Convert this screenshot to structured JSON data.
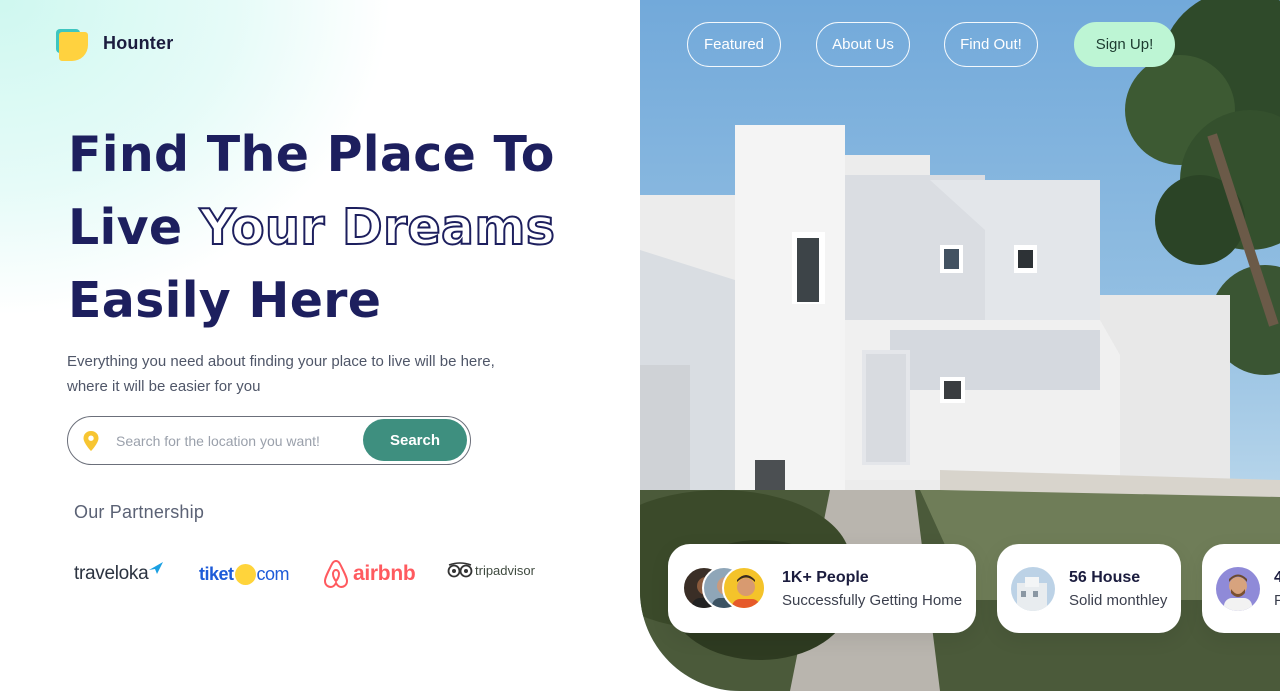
{
  "brand": {
    "name": "Hounter"
  },
  "hero": {
    "line1": "Find The Place To",
    "line2_solid": "Live",
    "line2_outline": "Your Dreams",
    "line3": "Easily Here",
    "subtext_line1": "Everything you need about finding your place to live will be here,",
    "subtext_line2": "where it will be easier for you"
  },
  "search": {
    "placeholder": "Search for the location you want!",
    "button_label": "Search",
    "icon": "location-pin-icon"
  },
  "partnership": {
    "title": "Our Partnership",
    "partners": [
      "traveloka",
      "tiket",
      "com",
      "airbnb",
      "tripadvisor"
    ]
  },
  "nav": {
    "featured": "Featured",
    "about": "About Us",
    "find_out": "Find Out!",
    "sign_up": "Sign Up!"
  },
  "stats": [
    {
      "title": "1K+ People",
      "subtitle": "Successfully Getting Home"
    },
    {
      "title": "56 House",
      "subtitle": "Solid monthley"
    },
    {
      "title": "4",
      "subtitle": "F"
    }
  ],
  "colors": {
    "heading": "#1d1f5e",
    "accent_green": "#3e8f7f",
    "signup_bg": "#bdf5d4",
    "logo_yellow": "#ffd23f",
    "logo_teal": "#3ec6c0"
  }
}
